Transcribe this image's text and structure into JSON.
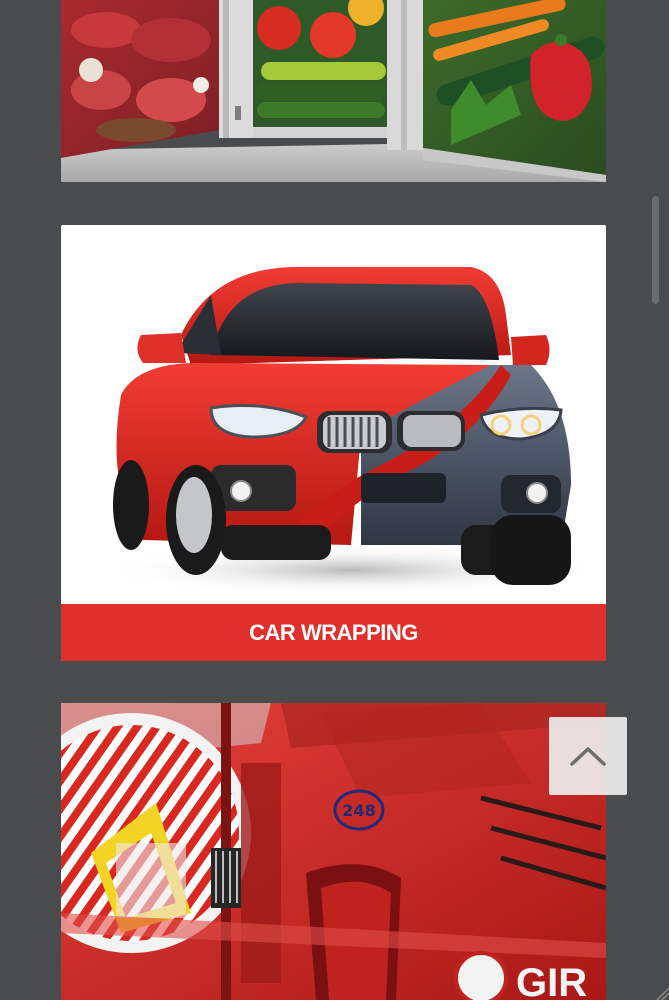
{
  "portfolio": {
    "items": [
      {
        "name": "Grocery storefront vinyl graphic",
        "caption": ""
      },
      {
        "name": "Car wrapping",
        "caption": "CAR WRAPPING"
      },
      {
        "name": "Red bus wrap with crest",
        "caption": "",
        "visible_text": [
          "248",
          "GIR"
        ]
      }
    ]
  },
  "controls": {
    "back_to_top_icon": "chevron-up-icon"
  },
  "colors": {
    "page_background": "#4a4b4d",
    "caption_bar": "#e0302d",
    "caption_text": "#ffffff",
    "back_to_top_bg": "#ececec",
    "chevron": "#6d6d6d"
  }
}
